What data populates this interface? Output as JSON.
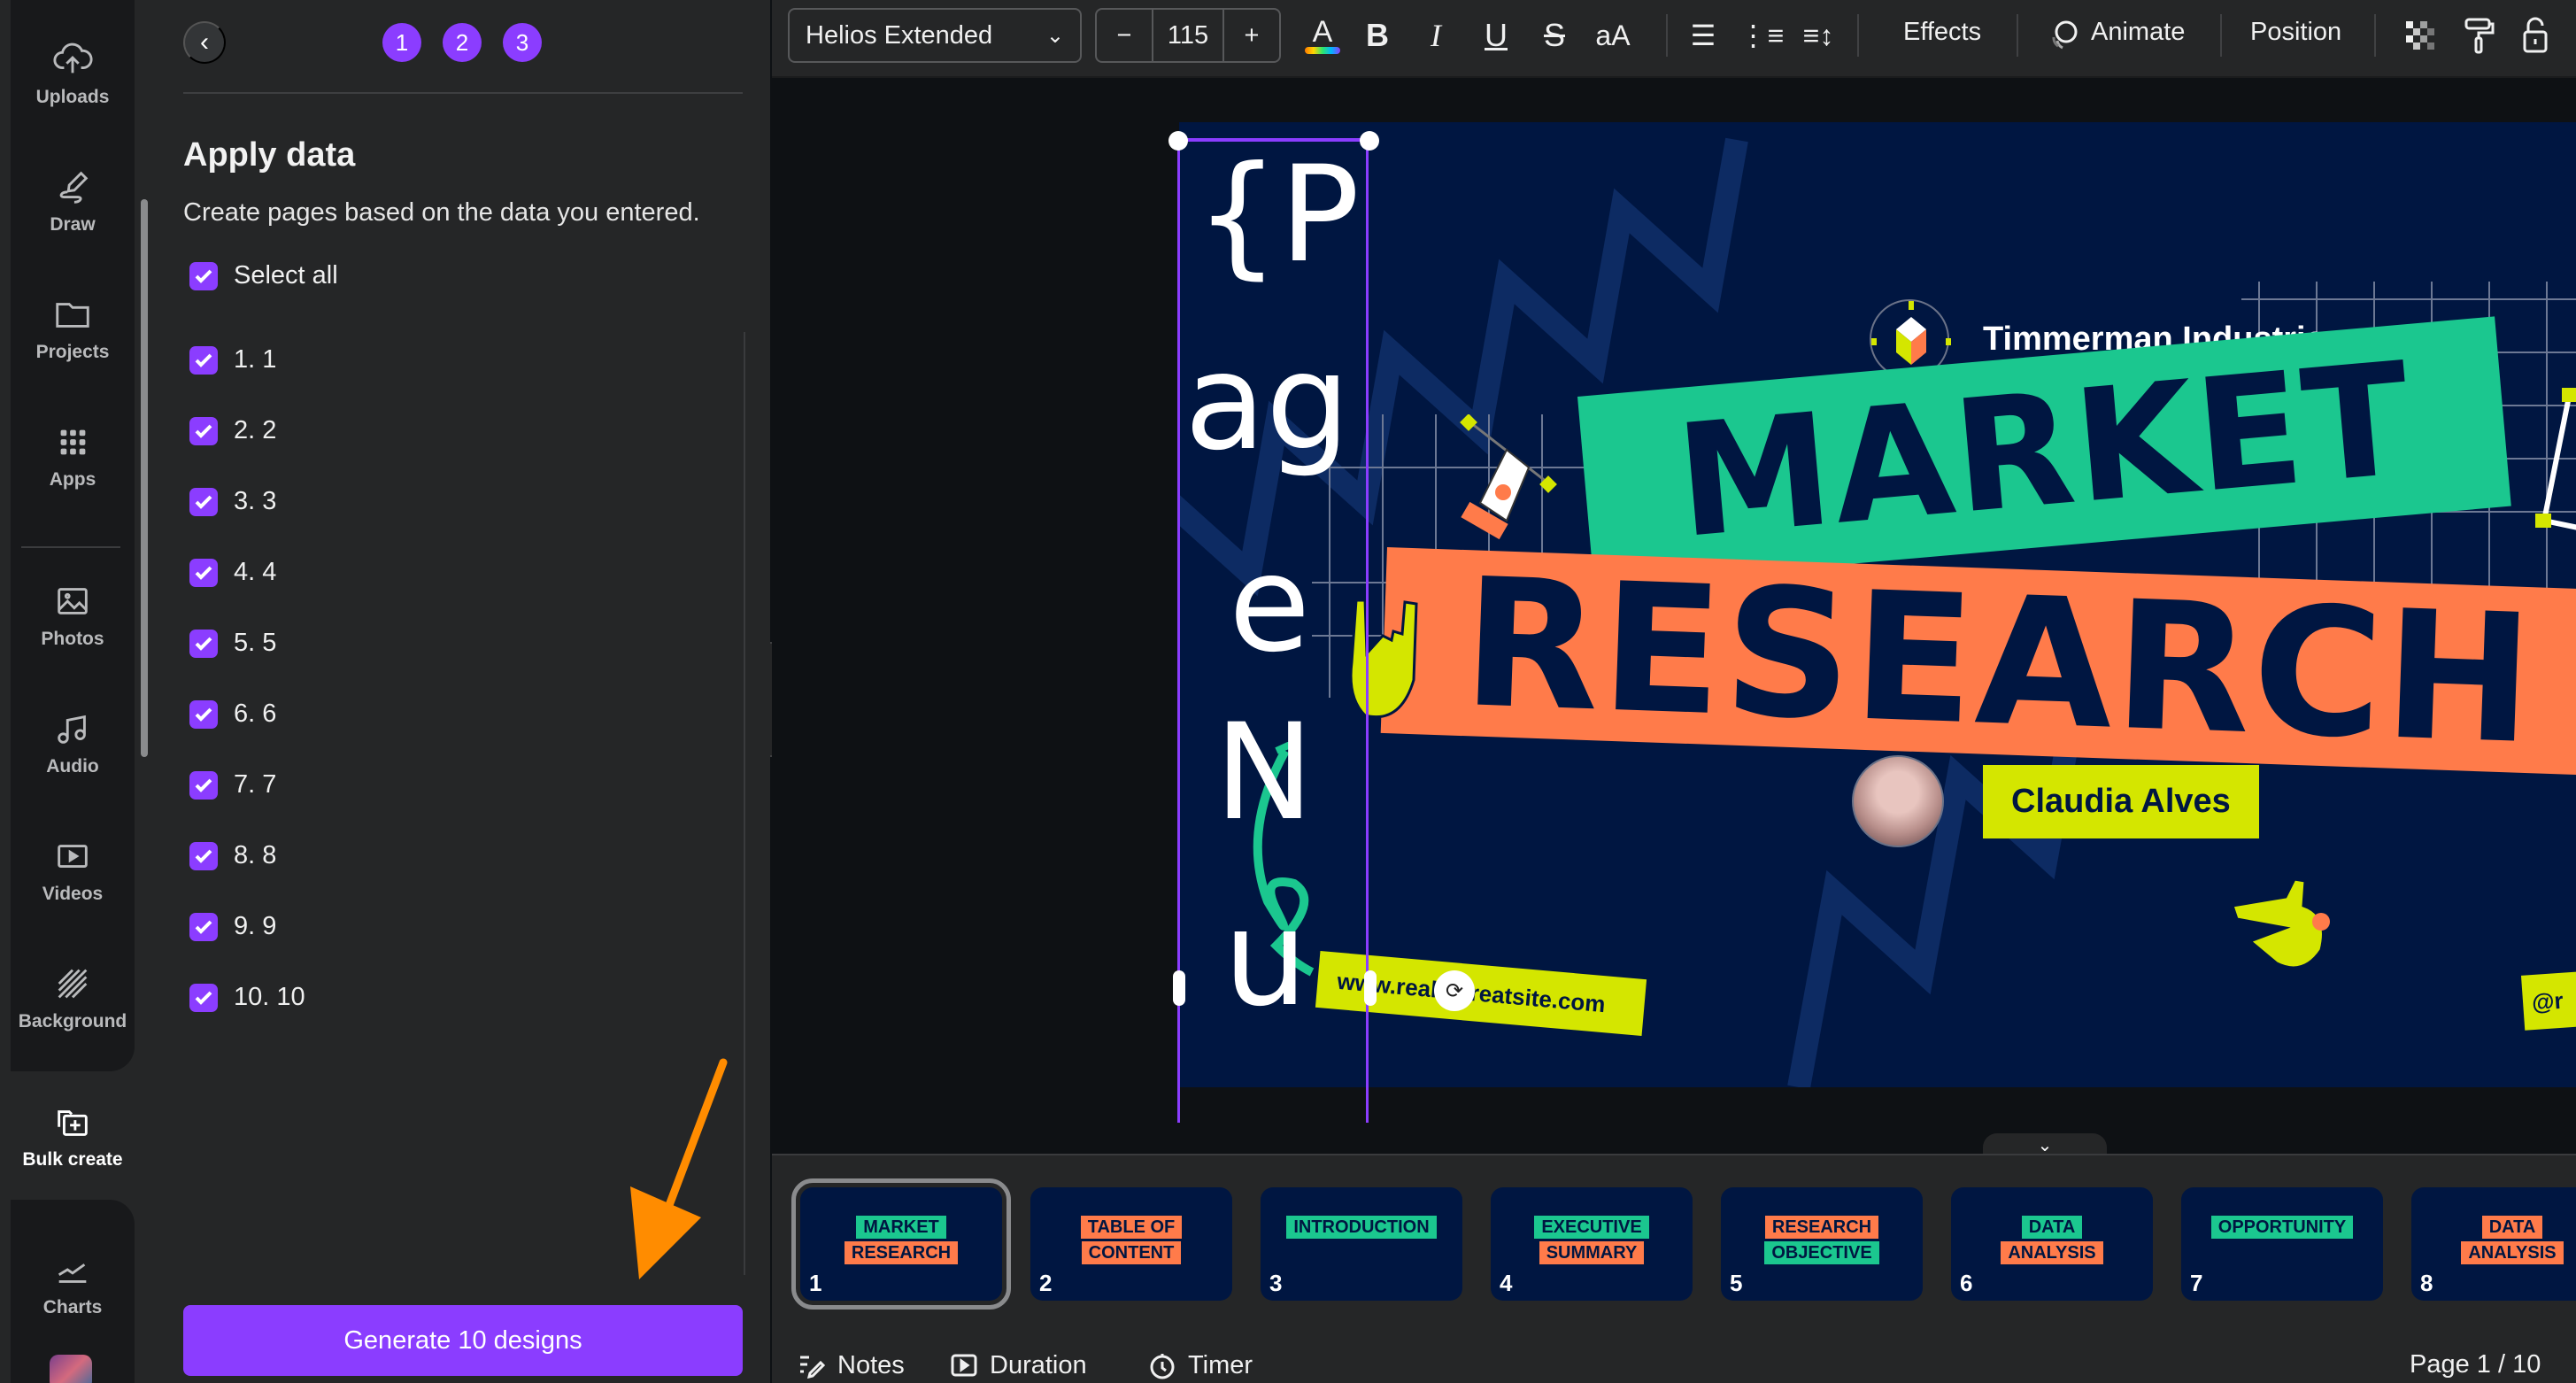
{
  "rail": {
    "items": [
      {
        "label": "Uploads",
        "icon": "cloud-upload-icon"
      },
      {
        "label": "Draw",
        "icon": "draw-icon"
      },
      {
        "label": "Projects",
        "icon": "folder-icon"
      },
      {
        "label": "Apps",
        "icon": "apps-grid-icon"
      },
      {
        "label": "Photos",
        "icon": "photo-icon"
      },
      {
        "label": "Audio",
        "icon": "music-note-icon"
      },
      {
        "label": "Videos",
        "icon": "video-icon"
      },
      {
        "label": "Background",
        "icon": "background-pattern-icon"
      },
      {
        "label": "Bulk create",
        "icon": "bulk-create-icon",
        "active": true
      },
      {
        "label": "Charts",
        "icon": "chart-line-icon"
      }
    ]
  },
  "panel": {
    "steps": [
      "1",
      "2",
      "3"
    ],
    "title": "Apply data",
    "description": "Create pages based on the data you entered.",
    "select_all_label": "Select all",
    "rows": [
      "1. 1",
      "2. 2",
      "3. 3",
      "4. 4",
      "5. 5",
      "6. 6",
      "7. 7",
      "8. 8",
      "9. 9",
      "10. 10"
    ],
    "generate_label": "Generate 10 designs"
  },
  "toolbar": {
    "font": "Helios Extended",
    "font_size": "115",
    "minus": "−",
    "plus": "+",
    "effects": "Effects",
    "animate": "Animate",
    "position": "Position"
  },
  "slide": {
    "company": "Timmerman Industries",
    "title_line1": "MARKET",
    "title_line2": "RESEARCH",
    "presenter": "Claudia Alves",
    "url": "www.reallygreatsite.com",
    "social": "@r",
    "placeholder_chars": [
      "{P",
      "ag",
      "e",
      "N",
      "u"
    ]
  },
  "pages": [
    {
      "num": "1",
      "title": "MARKET RESEARCH",
      "selected": true
    },
    {
      "num": "2",
      "title": "TABLE OF CONTENT"
    },
    {
      "num": "3",
      "title": "INTRODUCTION"
    },
    {
      "num": "4",
      "title": "EXECUTIVE SUMMARY"
    },
    {
      "num": "5",
      "title": "RESEARCH OBJECTIVE"
    },
    {
      "num": "6",
      "title": "DATA ANALYSIS"
    },
    {
      "num": "7",
      "title": "OPPORTUNITY"
    },
    {
      "num": "8",
      "title": "DATA ANALYSIS"
    }
  ],
  "footer": {
    "notes": "Notes",
    "duration": "Duration",
    "timer": "Timer",
    "page_indicator": "Page 1 / 10"
  },
  "colors": {
    "accent": "#8b3dff",
    "slide_bg": "#001641",
    "green": "#1bc78f",
    "orange": "#ff7b4a",
    "lime": "#d4e600"
  }
}
